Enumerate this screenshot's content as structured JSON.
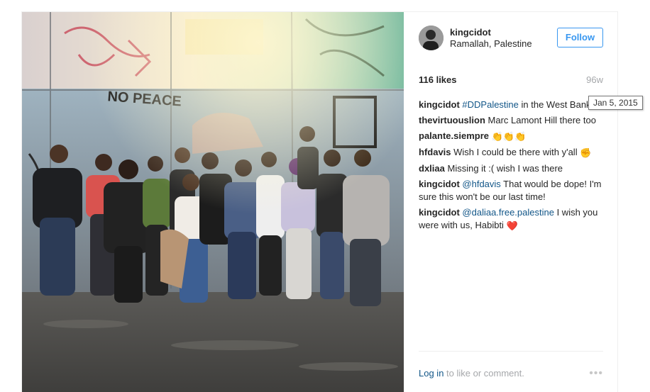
{
  "post": {
    "username": "kingcidot",
    "location": "Ramallah, Palestine",
    "follow_label": "Follow",
    "likes": "116 likes",
    "age": "96w",
    "tooltip": "Jan 5, 2015",
    "comments": [
      {
        "user": "kingcidot",
        "mention": "#DDPalestine",
        "text": " in the West Bank"
      },
      {
        "user": "thevirtuouslion",
        "text": "Marc Lamont Hill there too"
      },
      {
        "user": "palante.siempre",
        "emoji": "👏👏👏"
      },
      {
        "user": "hfdavis",
        "text": "Wish I could be there with y'all",
        "emoji": "✊"
      },
      {
        "user": "dxliaa",
        "text": "Missing it :( wish I was there"
      },
      {
        "user": "kingcidot",
        "mention": "@hfdavis",
        "text": " That would be dope! I'm sure this won't be our last time!"
      },
      {
        "user": "kingcidot",
        "mention": "@daliaa.free.palestine",
        "text": " I wish you were with us, Habibti",
        "emoji": "❤️"
      }
    ],
    "footer": {
      "login_link": "Log in",
      "login_text": " to like or comment.",
      "more_icon": "more-options-icon"
    },
    "photo": {
      "wall_graffiti_text": "NO PEACE",
      "accent_color": "#3897f0"
    }
  }
}
